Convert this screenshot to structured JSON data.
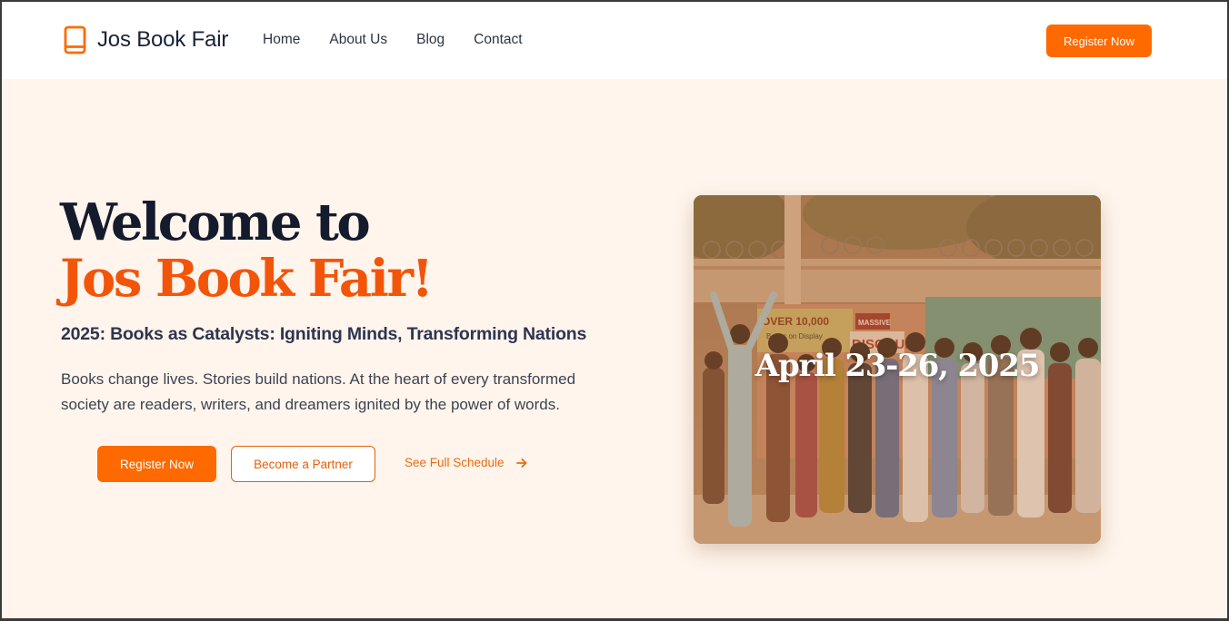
{
  "header": {
    "brand": "Jos Book Fair",
    "nav": [
      "Home",
      "About Us",
      "Blog",
      "Contact"
    ],
    "cta": "Register Now"
  },
  "hero": {
    "title_line1": "Welcome to",
    "title_line2": "Jos Book Fair!",
    "subtitle": "2025: Books as Catalysts: Igniting Minds, Transforming Nations",
    "intro": "Books change lives. Stories build nations. At the heart of every transformed society are readers, writers, and dreamers ignited by the power of words.",
    "buttons": {
      "register": "Register Now",
      "partner": "Become a Partner",
      "schedule": "See Full Schedule"
    }
  },
  "card": {
    "date": "April 23-26, 2025",
    "banner_text": [
      "OVER 10,000",
      "Books on Display",
      "MASSIVE",
      "DISCOUNT"
    ]
  },
  "icons": {
    "brand": "book-icon",
    "schedule": "arrow-right-icon"
  },
  "colors": {
    "accent": "#ff6a00",
    "title_dark": "#141b2d",
    "title_orange": "#f2550a",
    "hero_bg": "#fff5ec"
  }
}
